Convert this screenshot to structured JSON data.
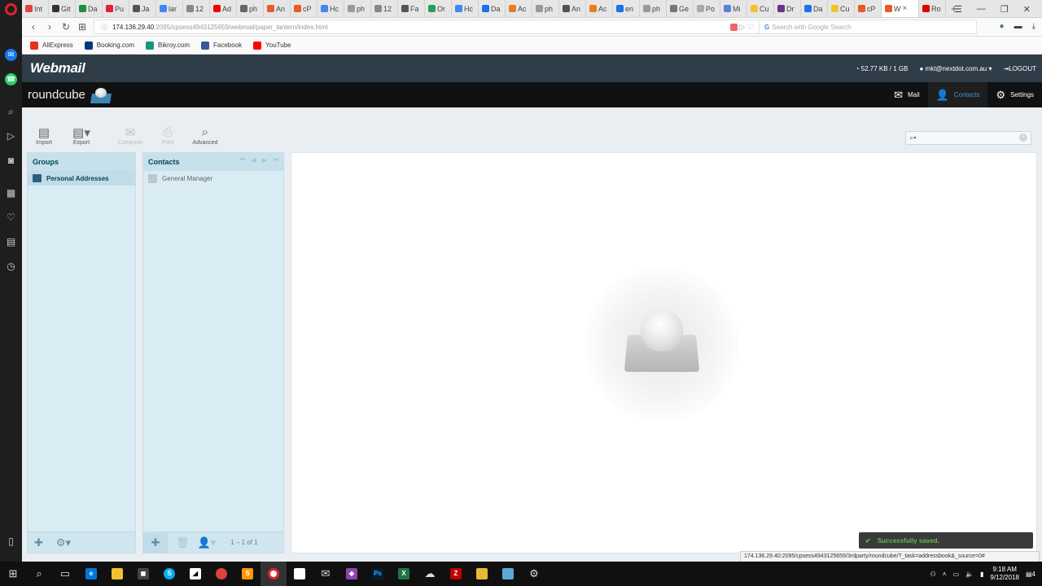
{
  "browser": {
    "tabs": [
      "Int",
      "Git",
      "Da",
      "Pu",
      "Ja",
      "lar",
      "12",
      "Ad",
      "ph",
      "An",
      "cP",
      "Hc",
      "ph",
      "12",
      "Fa",
      "Or",
      "Hc",
      "Da",
      "Ac",
      "ph",
      "An",
      "Ac",
      "en",
      "ph",
      "Ge",
      "Po",
      "Mi",
      "Cu",
      "Dr",
      "Da",
      "Cu",
      "cP"
    ],
    "active_tab": "W",
    "last_tab": "Ro",
    "url_host": "174.136.29.40",
    "url_path": ":2095/cpsess4943125659/webmail/paper_lantern/index.html",
    "search_placeholder": "Search with Google Search",
    "bookmarks": [
      {
        "label": "AliExpress",
        "color": "#e43225"
      },
      {
        "label": "Booking.com",
        "color": "#003580"
      },
      {
        "label": "Bikroy.com",
        "color": "#149777"
      },
      {
        "label": "Facebook",
        "color": "#3b5998"
      },
      {
        "label": "YouTube",
        "color": "#ff0000"
      }
    ]
  },
  "webmail": {
    "logo": "Webmail",
    "quota": "52.77 KB / 1 GB",
    "user": "mkt@nextdot.com.au",
    "logout": "LOGOUT"
  },
  "roundcube": {
    "logo": "roundcube",
    "nav": {
      "mail": "Mail",
      "contacts": "Contacts",
      "settings": "Settings"
    }
  },
  "toolbar": {
    "import": "Import",
    "export": "Export",
    "compose": "Compose",
    "print": "Print",
    "advanced": "Advanced"
  },
  "groups": {
    "title": "Groups",
    "items": [
      "Personal Addresses"
    ]
  },
  "contacts": {
    "title": "Contacts",
    "items": [
      "General Manager"
    ],
    "count": "1 – 1 of 1"
  },
  "toast": "Successfully saved.",
  "status_url": "174.136.29.40:2095/cpsess4943125659/3rdparty/roundcube/?_task=addressbook&_source=0#",
  "taskbar": {
    "time": "9:18 AM",
    "date": "9/12/2018",
    "notifications": "4"
  },
  "colors": {
    "header": "#2f3d48",
    "accent": "#3a95d6",
    "panel": "#d9ecf4",
    "toast_text": "#5ebb4b"
  }
}
